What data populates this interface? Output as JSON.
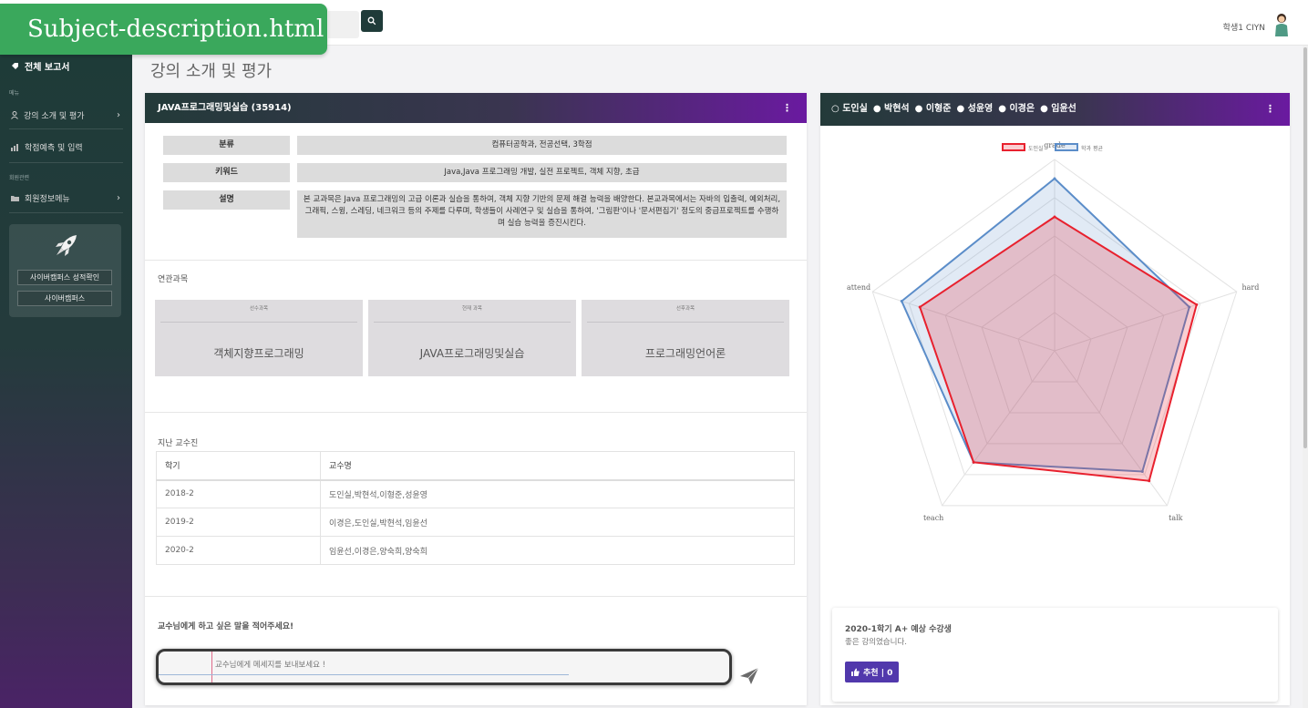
{
  "file_tab": "Subject-description.html",
  "topbar": {
    "user_name": "학생1 CIYN"
  },
  "sidebar": {
    "main_label": "전체 보고서",
    "section_menu": "메뉴",
    "item_lecture": "강의 소개 및 평가",
    "item_grade": "학점예측 및 입력",
    "section_member": "회원관련",
    "item_member": "회원정보메뉴",
    "btn_cyber_grade": "사이버캠퍼스 성적확인",
    "btn_cyber": "사이버캠퍼스"
  },
  "page_title": "강의 소개 및 평가",
  "course": {
    "header": "JAVA프로그래밍및실습 (35914)",
    "rows": [
      {
        "label": "분류",
        "value": "컴퓨터공학과, 전공선택, 3학점"
      },
      {
        "label": "키워드",
        "value": "Java,Java 프로그래밍 개발, 실전 프로젝트, 객체 지향, 초급"
      },
      {
        "label": "설명",
        "value": "본 교과목은 Java 프로그래밍의 고급 이론과 실습을 통하여, 객체 지향 기반의 문제 해결 능력을 배양한다. 본교과목에서는 자바의 입출력, 예외처리, 그래픽, 스윙, 스레딩, 네크워크 등의 주제를 다루며, 학생들이 사례연구 및 실습을 통하여, '그림판'이나 '문서편집기' 정도의 중급프로젝트를 수행하며 실습 능력을 증진시킨다."
      }
    ],
    "related_title": "연관과목",
    "related": [
      {
        "small": "선수과목",
        "name": "객체지향프로그래밍"
      },
      {
        "small": "현재 과목",
        "name": "JAVA프로그래밍및실습"
      },
      {
        "small": "선후과목",
        "name": "프로그래밍언어론"
      }
    ],
    "professors_title": "지난 교수진",
    "prof_table": {
      "headers": [
        "학기",
        "교수명"
      ],
      "rows": [
        [
          "2018-2",
          "도인실,박현석,이형준,성윤영"
        ],
        [
          "2019-2",
          "이경은,도인실,박현석,임윤선"
        ],
        [
          "2020-2",
          "임윤선,이경은,양숙희,양숙희"
        ]
      ]
    },
    "message_title": "교수님에게 하고 싶은 말을 적어주세요!",
    "message_placeholder": "교수님에게 메세지를 보내보세요 !"
  },
  "radar_card": {
    "professors": [
      "도인실",
      "박현석",
      "이형준",
      "성윤영",
      "이경은",
      "임윤선"
    ],
    "selected": "도인실",
    "comment_title": "2020-1학기 A+ 예상 수강생",
    "comment_text": "좋은 강의였습니다.",
    "recommend_label": "추천 | 0"
  },
  "chart_data": {
    "type": "radar",
    "categories": [
      "grade",
      "hard",
      "talk",
      "teach",
      "attend"
    ],
    "series": [
      {
        "name": "도인실",
        "values": [
          3.5,
          3.9,
          4.2,
          3.6,
          3.7
        ],
        "color": "#e8212e"
      },
      {
        "name": "학과 평균",
        "values": [
          4.5,
          3.7,
          3.9,
          3.6,
          4.2
        ],
        "color": "#5b8dc9"
      }
    ],
    "rmax": 5,
    "legend": "top"
  }
}
